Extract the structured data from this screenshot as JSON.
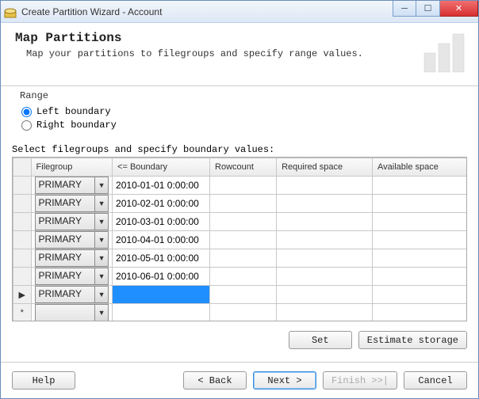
{
  "window": {
    "title": "Create Partition Wizard - Account"
  },
  "header": {
    "heading": "Map Partitions",
    "sub": "Map your partitions to filegroups and specify range values."
  },
  "range": {
    "legend": "Range",
    "left_label": "Left boundary",
    "right_label": "Right boundary",
    "selected": "left"
  },
  "grid": {
    "select_label": "Select filegroups and specify boundary values:",
    "headers": {
      "filegroup": "Filegroup",
      "boundary": "<= Boundary",
      "rowcount": "Rowcount",
      "required": "Required space",
      "available": "Available space"
    },
    "rows": [
      {
        "marker": "",
        "filegroup": "PRIMARY",
        "boundary": "2010-01-01 0:00:00",
        "rowcount": "",
        "required": "",
        "available": ""
      },
      {
        "marker": "",
        "filegroup": "PRIMARY",
        "boundary": "2010-02-01 0:00:00",
        "rowcount": "",
        "required": "",
        "available": ""
      },
      {
        "marker": "",
        "filegroup": "PRIMARY",
        "boundary": "2010-03-01 0:00:00",
        "rowcount": "",
        "required": "",
        "available": ""
      },
      {
        "marker": "",
        "filegroup": "PRIMARY",
        "boundary": "2010-04-01 0:00:00",
        "rowcount": "",
        "required": "",
        "available": ""
      },
      {
        "marker": "",
        "filegroup": "PRIMARY",
        "boundary": "2010-05-01 0:00:00",
        "rowcount": "",
        "required": "",
        "available": ""
      },
      {
        "marker": "",
        "filegroup": "PRIMARY",
        "boundary": "2010-06-01 0:00:00",
        "rowcount": "",
        "required": "",
        "available": ""
      },
      {
        "marker": "▶",
        "filegroup": "PRIMARY",
        "boundary": "",
        "rowcount": "",
        "required": "",
        "available": "",
        "boundary_active": true
      },
      {
        "marker": "*",
        "filegroup": "",
        "boundary": "",
        "rowcount": "",
        "required": "",
        "available": ""
      }
    ]
  },
  "buttons": {
    "set": "Set",
    "estimate": "Estimate storage",
    "help": "Help",
    "back": "< Back",
    "next": "Next >",
    "finish": "Finish >>|",
    "cancel": "Cancel"
  }
}
